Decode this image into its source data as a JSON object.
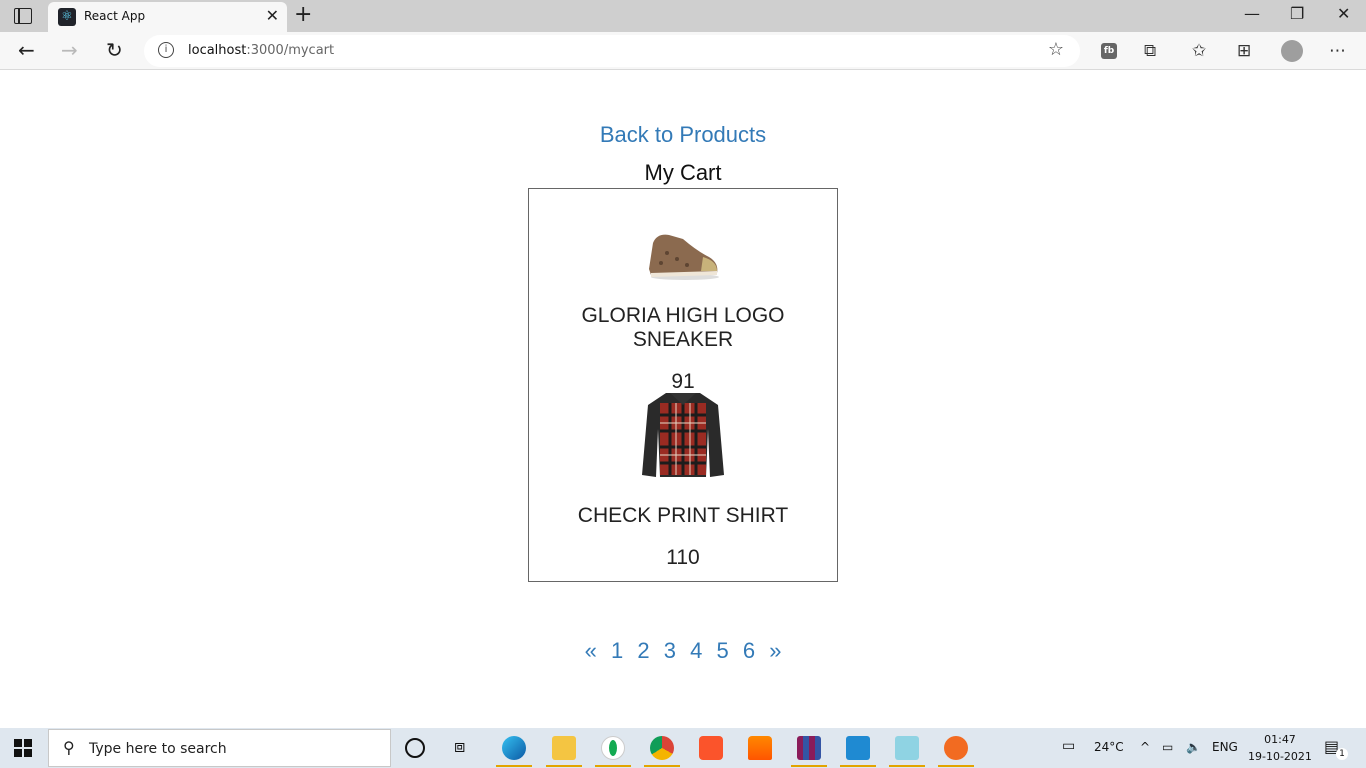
{
  "browser": {
    "tab_title": "React App",
    "url_host": "localhost",
    "url_path": ":3000/mycart"
  },
  "page": {
    "back_link": "Back to Products",
    "cart_title": "My Cart",
    "items": [
      {
        "name": "GLORIA HIGH LOGO SNEAKER",
        "price": "91",
        "icon": "sneaker-image"
      },
      {
        "name": "CHECK PRINT SHIRT",
        "price": "110",
        "icon": "shirt-image"
      }
    ],
    "pagination": {
      "prev": "«",
      "pages": [
        "1",
        "2",
        "3",
        "4",
        "5",
        "6"
      ],
      "next": "»"
    }
  },
  "taskbar": {
    "search_placeholder": "Type here to search",
    "weather": "24°C",
    "language": "ENG",
    "time": "01:47",
    "date": "19-10-2021",
    "notification_count": "1"
  },
  "colors": {
    "link": "#337ab7",
    "border": "#666666"
  }
}
